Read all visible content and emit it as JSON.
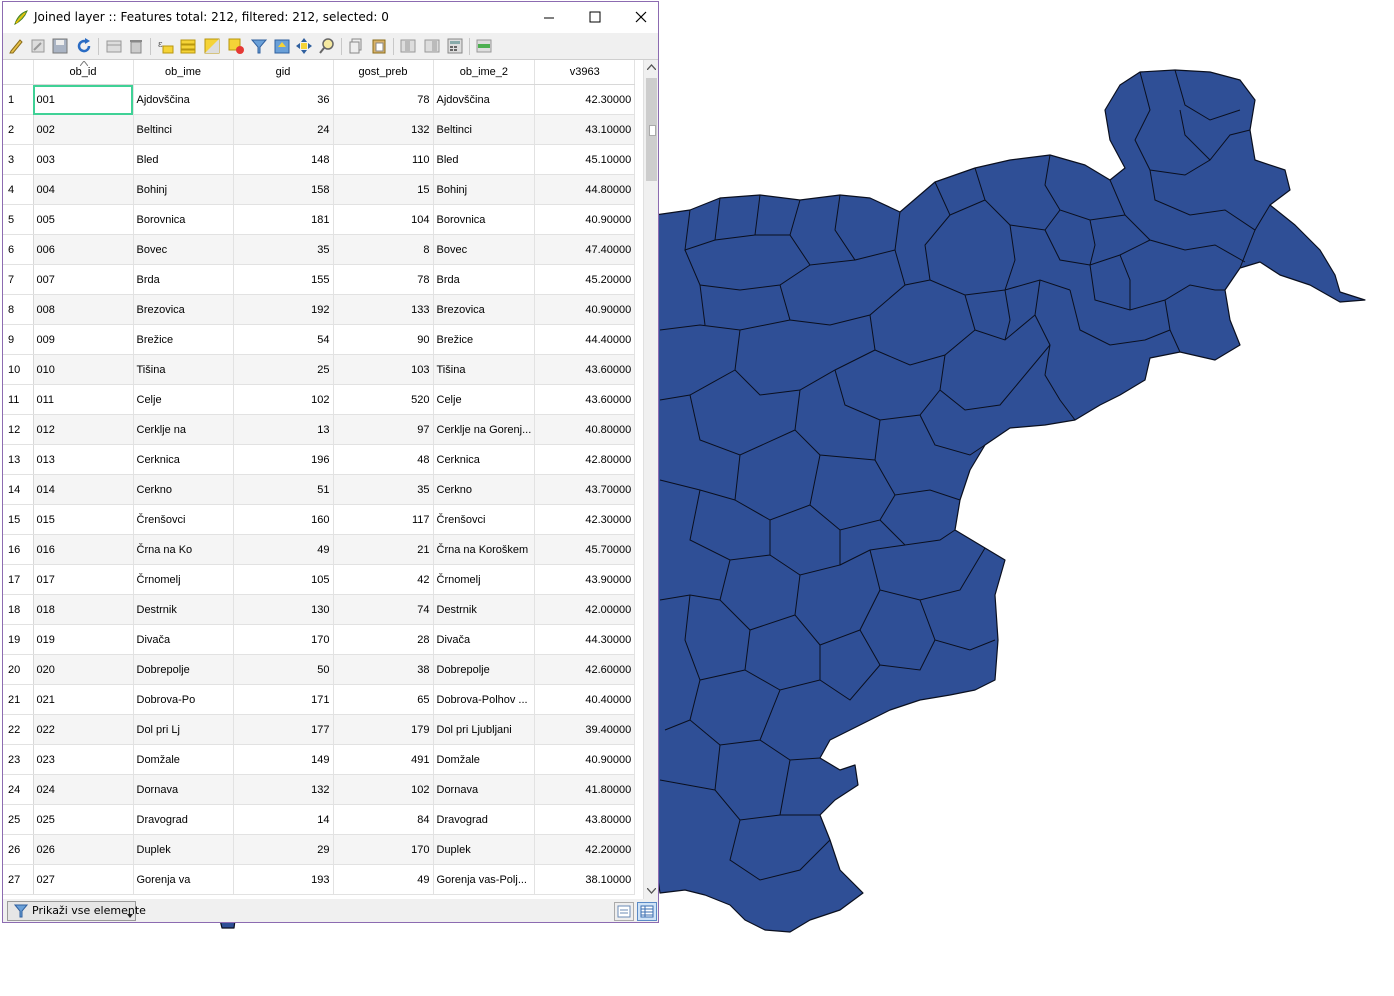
{
  "window": {
    "title": "Joined layer :: Features total: 212, filtered: 212, selected: 0"
  },
  "toolbar": {
    "icons": [
      "pencil-icon",
      "multi-edit-icon",
      "save-icon",
      "reload-icon",
      "add-feature-icon",
      "delete-icon",
      "expression-select-icon",
      "select-all-icon",
      "invert-selection-icon",
      "deselect-icon",
      "filter-icon",
      "move-to-top-icon",
      "pan-to-selection-icon",
      "zoom-to-selection-icon",
      "copy-icon",
      "paste-icon",
      "new-field-icon",
      "delete-field-icon",
      "field-calculator-icon",
      "conditional-formatting-icon"
    ]
  },
  "table": {
    "columns": [
      "ob_id",
      "ob_ime",
      "gid",
      "gost_preb",
      "ob_ime_2",
      "v3963"
    ],
    "rows": [
      [
        "1",
        "001",
        "Ajdovščina",
        "36",
        "78",
        "Ajdovščina",
        "42.30000"
      ],
      [
        "2",
        "002",
        "Beltinci",
        "24",
        "132",
        "Beltinci",
        "43.10000"
      ],
      [
        "3",
        "003",
        "Bled",
        "148",
        "110",
        "Bled",
        "45.10000"
      ],
      [
        "4",
        "004",
        "Bohinj",
        "158",
        "15",
        "Bohinj",
        "44.80000"
      ],
      [
        "5",
        "005",
        "Borovnica",
        "181",
        "104",
        "Borovnica",
        "40.90000"
      ],
      [
        "6",
        "006",
        "Bovec",
        "35",
        "8",
        "Bovec",
        "47.40000"
      ],
      [
        "7",
        "007",
        "Brda",
        "155",
        "78",
        "Brda",
        "45.20000"
      ],
      [
        "8",
        "008",
        "Brezovica",
        "192",
        "133",
        "Brezovica",
        "40.90000"
      ],
      [
        "9",
        "009",
        "Brežice",
        "54",
        "90",
        "Brežice",
        "44.40000"
      ],
      [
        "10",
        "010",
        "Tišina",
        "25",
        "103",
        "Tišina",
        "43.60000"
      ],
      [
        "11",
        "011",
        "Celje",
        "102",
        "520",
        "Celje",
        "43.60000"
      ],
      [
        "12",
        "012",
        "Cerklje na",
        "13",
        "97",
        "Cerklje na Gorenj...",
        "40.80000"
      ],
      [
        "13",
        "013",
        "Cerknica",
        "196",
        "48",
        "Cerknica",
        "42.80000"
      ],
      [
        "14",
        "014",
        "Cerkno",
        "51",
        "35",
        "Cerkno",
        "43.70000"
      ],
      [
        "15",
        "015",
        "Črenšovci",
        "160",
        "117",
        "Črenšovci",
        "42.30000"
      ],
      [
        "16",
        "016",
        "Črna na Ko",
        "49",
        "21",
        "Črna na Koroškem",
        "45.70000"
      ],
      [
        "17",
        "017",
        "Črnomelj",
        "105",
        "42",
        "Črnomelj",
        "43.90000"
      ],
      [
        "18",
        "018",
        "Destrnik",
        "130",
        "74",
        "Destrnik",
        "42.00000"
      ],
      [
        "19",
        "019",
        "Divača",
        "170",
        "28",
        "Divača",
        "44.30000"
      ],
      [
        "20",
        "020",
        "Dobrepolje",
        "50",
        "38",
        "Dobrepolje",
        "42.60000"
      ],
      [
        "21",
        "021",
        "Dobrova-Po",
        "171",
        "65",
        "Dobrova-Polhov ...",
        "40.40000"
      ],
      [
        "22",
        "022",
        "Dol pri Lj",
        "177",
        "179",
        "Dol pri Ljubljani",
        "39.40000"
      ],
      [
        "23",
        "023",
        "Domžale",
        "149",
        "491",
        "Domžale",
        "40.90000"
      ],
      [
        "24",
        "024",
        "Dornava",
        "132",
        "102",
        "Dornava",
        "41.80000"
      ],
      [
        "25",
        "025",
        "Dravograd",
        "14",
        "84",
        "Dravograd",
        "43.80000"
      ],
      [
        "26",
        "026",
        "Duplek",
        "29",
        "170",
        "Duplek",
        "42.20000"
      ],
      [
        "27",
        "027",
        "Gorenja va",
        "193",
        "49",
        "Gorenja vas-Polj...",
        "38.10000"
      ]
    ]
  },
  "status": {
    "filter_button": "Prikaži vse elemente"
  },
  "colors": {
    "map_fill": "#2f4f96",
    "map_stroke": "#0a0f1f",
    "selection_outline": "#3fd196",
    "window_border": "#8c6bb1"
  }
}
